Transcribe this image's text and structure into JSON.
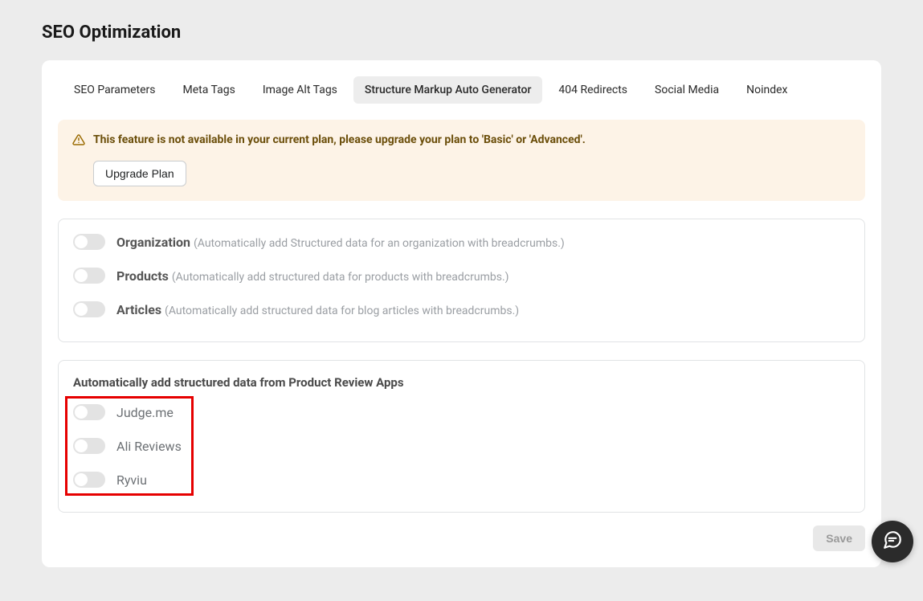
{
  "page": {
    "title": "SEO Optimization"
  },
  "tabs": [
    {
      "label": "SEO Parameters",
      "active": false
    },
    {
      "label": "Meta Tags",
      "active": false
    },
    {
      "label": "Image Alt Tags",
      "active": false
    },
    {
      "label": "Structure Markup Auto Generator",
      "active": true
    },
    {
      "label": "404 Redirects",
      "active": false
    },
    {
      "label": "Social Media",
      "active": false
    },
    {
      "label": "Noindex",
      "active": false
    }
  ],
  "banner": {
    "text": "This feature is not available in your current plan, please upgrade your plan to 'Basic' or 'Advanced'.",
    "upgrade_label": "Upgrade Plan"
  },
  "structured_items": [
    {
      "name": "Organization",
      "desc": "(Automatically add Structured data for an organization with breadcrumbs.)"
    },
    {
      "name": "Products",
      "desc": "(Automatically add structured data for products with breadcrumbs.)"
    },
    {
      "name": "Articles",
      "desc": "(Automatically add structured data for blog articles with breadcrumbs.)"
    }
  ],
  "review_apps": {
    "heading": "Automatically add structured data from Product Review Apps",
    "items": [
      {
        "name": "Judge.me"
      },
      {
        "name": "Ali Reviews"
      },
      {
        "name": "Ryviu"
      }
    ]
  },
  "save": {
    "label": "Save"
  },
  "chat": {
    "icon": "chat-icon"
  }
}
